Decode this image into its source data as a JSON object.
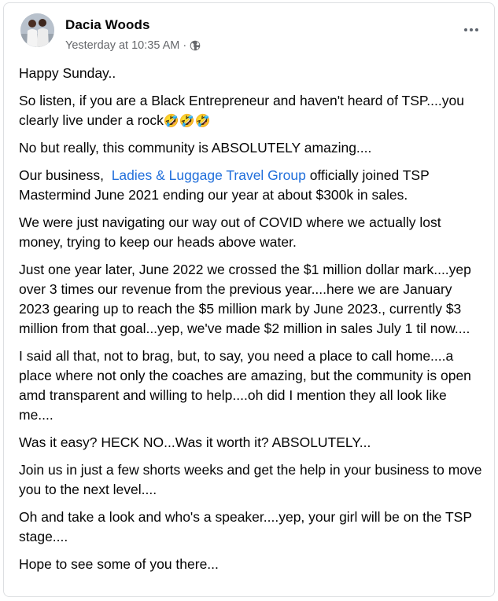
{
  "post": {
    "author": "Dacia Woods",
    "timestamp": "Yesterday at 10:35 AM",
    "separator": "·",
    "privacy_icon": "globe-icon",
    "more_icon": "more-horizontal-icon",
    "paragraphs": {
      "p1": "Happy Sunday..",
      "p2": "So listen, if you are a Black Entrepreneur and haven't heard of TSP....you clearly live under a rock",
      "p2_emoji": "🤣🤣🤣",
      "p3": "No but really,  this community is ABSOLUTELY amazing....",
      "p4_before": "Our business,  ",
      "p4_link": "Ladies & Luggage Travel Group",
      "p4_after": " officially joined TSP Mastermind June 2021 ending our year at about $300k in sales.",
      "p5": "We were just navigating our way out of COVID where we actually lost money, trying to keep our heads above water.",
      "p6": "Just one year later, June 2022 we crossed the $1 million dollar mark....yep over 3 times our revenue from the previous year....here we are January 2023 gearing up to reach the  $5 million mark by June 2023., currently $3 million from that goal...yep, we've made $2 million in sales July 1 til now....",
      "p7": "I said all that, not to brag, but, to say, you need a place to call home....a place where not only the coaches are amazing, but the community is open amd transparent and willing to help....oh did I mention they all look like me....",
      "p8": "Was it easy? HECK NO...Was it worth it? ABSOLUTELY...",
      "p9": "Join us in just a few shorts weeks and get the help in your business to move you to the next level....",
      "p10": "Oh and take a look and who's a speaker....yep, your girl will be on the TSP stage....",
      "p11": "Hope to see some of you there..."
    }
  },
  "colors": {
    "link": "#216fdb",
    "meta": "#65676b",
    "text": "#050505",
    "border": "#dddfe2"
  }
}
